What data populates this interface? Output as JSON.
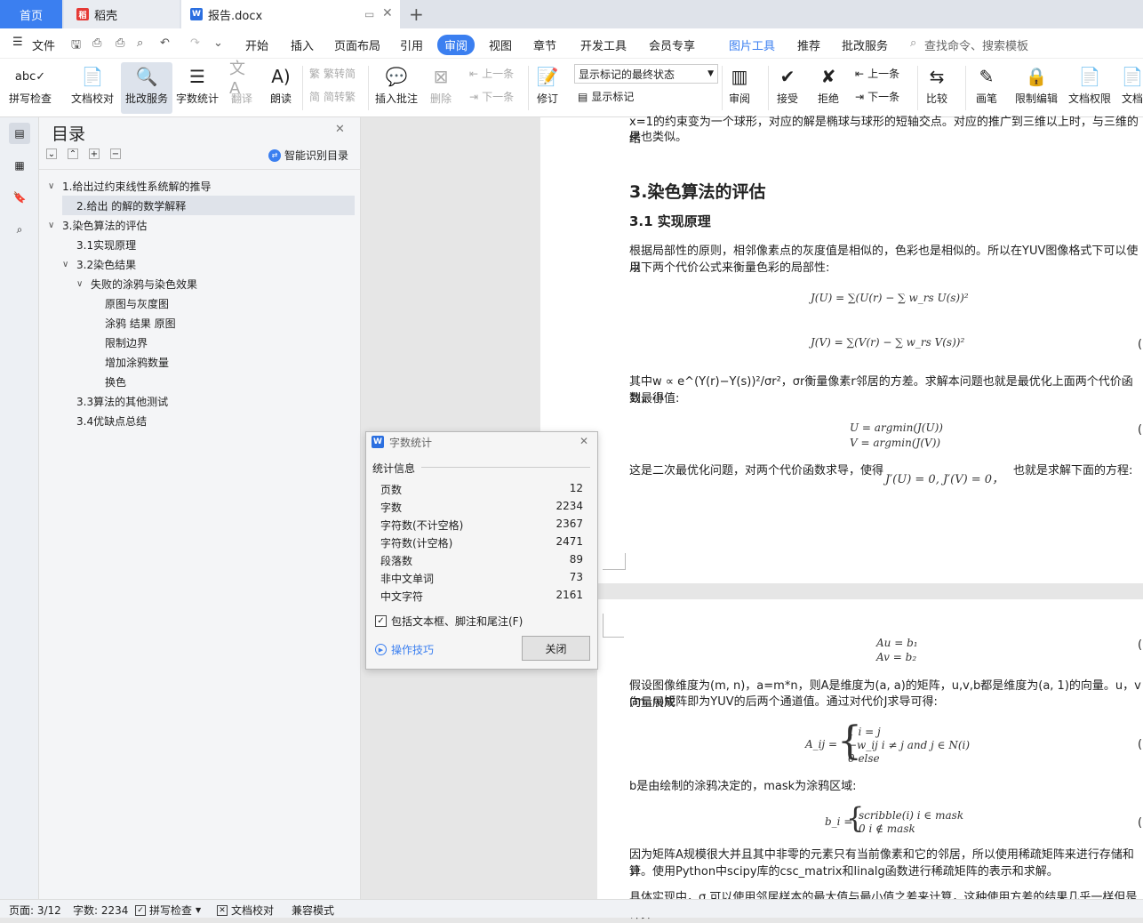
{
  "tabs": {
    "home": "首页",
    "daoke": "稻壳",
    "doc": "报告.docx"
  },
  "menu": {
    "file": "文件",
    "items": [
      "开始",
      "插入",
      "页面布局",
      "引用",
      "审阅",
      "视图",
      "章节",
      "开发工具",
      "会员专享",
      "图片工具",
      "推荐",
      "批改服务"
    ],
    "search": "查找命令、搜索模板"
  },
  "ribbon": {
    "spell": "拼写检查",
    "proof": "文档校对",
    "correct": "批改服务",
    "wordcount": "字数统计",
    "translate": "翻译",
    "read": "朗读",
    "trad": "繁转简",
    "simp": "简转繁",
    "insert_comment": "插入批注",
    "delete": "删除",
    "prev": "上一条",
    "next": "下一条",
    "revise": "修订",
    "markup_select": "显示标记的最终状态",
    "show_markup": "显示标记",
    "review": "审阅",
    "accept": "接受",
    "reject": "拒绝",
    "prev2": "上一条",
    "next2": "下一条",
    "compare": "比较",
    "pen": "画笔",
    "restrict": "限制编辑",
    "perm": "文档权限",
    "doc": "文档"
  },
  "toc": {
    "title": "目录",
    "smart": "智能识别目录",
    "items": [
      {
        "label": "1.给出过约束线性系统解的推导",
        "arrow": "∨"
      },
      {
        "label": "2.给出  的解的数学解释",
        "arrow": ""
      },
      {
        "label": "3.染色算法的评估",
        "arrow": "∨"
      },
      {
        "label": "3.1实现原理",
        "arrow": ""
      },
      {
        "label": "3.2染色结果",
        "arrow": "∨"
      },
      {
        "label": "失败的涂鸦与染色效果",
        "arrow": "∨"
      },
      {
        "label": "原图与灰度图",
        "arrow": ""
      },
      {
        "label": "涂鸦 结果 原图",
        "arrow": ""
      },
      {
        "label": "限制边界",
        "arrow": ""
      },
      {
        "label": "增加涂鸦数量",
        "arrow": ""
      },
      {
        "label": "换色",
        "arrow": ""
      },
      {
        "label": "3.3算法的其他测试",
        "arrow": ""
      },
      {
        "label": "3.4优缺点总结",
        "arrow": ""
      }
    ]
  },
  "doc": {
    "top_line1": "x=1的约束变为一个球形，对应的解是椭球与球形的短轴交点。对应的推广到三维以上时，与三维的结",
    "top_line2": "果也类似。",
    "h1": "3.染色算法的评估",
    "h2": "3.1 实现原理",
    "p1a": "根据局部性的原则，相邻像素点的灰度值是相似的，色彩也是相似的。所以在YUV图像格式下可以使用",
    "p1b": "以下两个代价公式来衡量色彩的局部性:",
    "eq1": "J(U) = ∑(U(r) − ∑ w_rs U(s))²",
    "eq2": "J(V) = ∑(V(r) − ∑ w_rs V(s))²",
    "p2a": "其中w ∝ e^(Y(r)−Y(s))²/σr²，σr衡量像素r邻居的方差。求解本问题也就是最优化上面两个代价函数，得",
    "p2b": "到最小值:",
    "eq3": "U = argmin(J(U))",
    "eq4": "V = argmin(J(V))",
    "p3a": "这是二次最优化问题，对两个代价函数求导，使得",
    "p3m": "J′(U) = 0, J′(V) = 0，",
    "p3b": "也就是求解下面的方程:",
    "eq5": "Au = b₁",
    "eq6": "Av = b₂",
    "p4a": "假设图像维度为(m, n)，a=m*n，则A是维度为(a, a)的矩阵，u,v,b都是维度为(a, 1)的向量。u，v向量展成",
    "p4b": "(m ,n)矩阵即为YUV的后两个通道值。通过对代价J求导可得:",
    "eq7a": "A_ij =",
    "eq7r1": "1          i = j",
    "eq7r2": "−w_ij    i ≠ j  and  j ∈ N(i)",
    "eq7r3": "0          else",
    "p5": "b是由绘制的涂鸦决定的，mask为涂鸦区域:",
    "eq8a": "b_i =",
    "eq8r1": "scribble(i)   i ∈ mask",
    "eq8r2": "0                i ∉ mask",
    "p6a": "因为矩阵A规模很大并且其中非零的元素只有当前像素和它的邻居，所以使用稀疏矩阵来进行存储和计",
    "p6b": "算。使用Python中scipy库的csc_matrix和linalg函数进行稀疏矩阵的表示和求解。",
    "p7": "具体实现中，σ 可以使用邻居样本的最大值与最小值之差来计算，这种使用方差的结果几乎一样但是计算"
  },
  "dialog": {
    "title": "字数统计",
    "section": "统计信息",
    "rows": [
      {
        "k": "页数",
        "v": "12"
      },
      {
        "k": "字数",
        "v": "2234"
      },
      {
        "k": "字符数(不计空格)",
        "v": "2367"
      },
      {
        "k": "字符数(计空格)",
        "v": "2471"
      },
      {
        "k": "段落数",
        "v": "89"
      },
      {
        "k": "非中文单词",
        "v": "73"
      },
      {
        "k": "中文字符",
        "v": "2161"
      }
    ],
    "include": "包括文本框、脚注和尾注(F)",
    "tips": "操作技巧",
    "close": "关闭"
  },
  "status": {
    "page": "页面: 3/12",
    "words": "字数: 2234",
    "spell": "拼写检查",
    "proof": "文档校对",
    "compat": "兼容模式"
  },
  "colors": {
    "accent": "#3b7ff0"
  }
}
